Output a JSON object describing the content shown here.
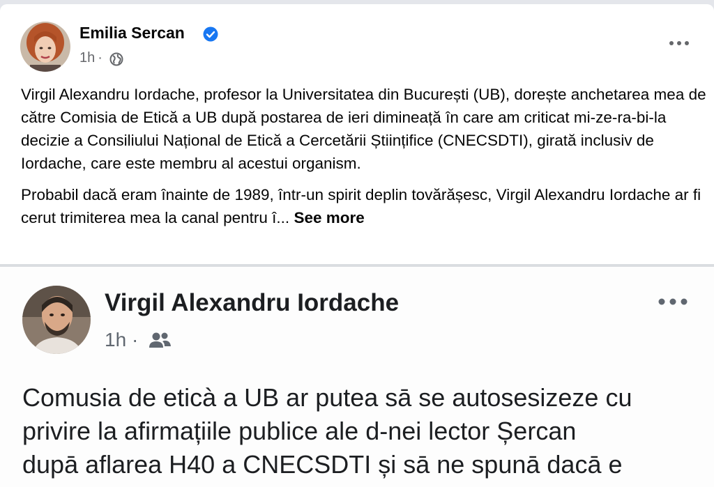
{
  "post": {
    "author": "Emilia Sercan",
    "time": "1h",
    "separator": "·",
    "paragraph1": "Virgil Alexandru Iordache, profesor la Universitatea din București (UB), dorește anchetarea mea de către Comisia de Etică a UB după postarea de ieri dimineață în care am criticat mi-ze-ra-bi-la decizie a Consiliului Național de Etică a Cercetării Științifice (CNECSDTI), girată inclusiv de Iordache, care este membru al acestui organism.",
    "paragraph2": "Probabil dacă eram înainte de 1989, într-un spirit deplin tovărășesc, Virgil Alexandru Iordache ar fi cerut trimiterea mea la canal pentru î...",
    "see_more": "See more"
  },
  "embedded_post": {
    "author": "Virgil Alexandru Iordache",
    "time": "1h",
    "separator": "·",
    "lines": [
      "Comusia de eticà a UB ar putea sā se autosesizeze cu",
      "privire la afirmațiile publice ale d-nei lector Șercan",
      "dupā aflarea H40 a CNECSDTI și sā ne spunā dacā e"
    ]
  },
  "icons": {
    "verified": "verified-badge-icon",
    "privacy_public": "globe-icon",
    "privacy_friends": "friends-icon",
    "more": "more-options-icon"
  },
  "colors": {
    "verified_blue": "#1877f2",
    "secondary_text": "#65676b",
    "divider": "#dadde1"
  }
}
